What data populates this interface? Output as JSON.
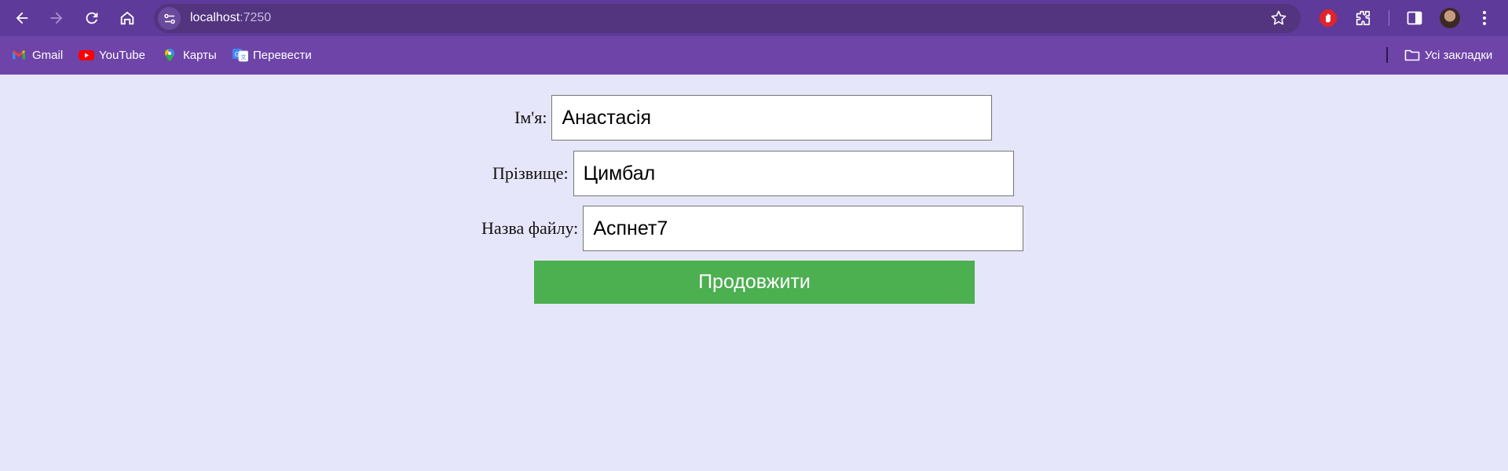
{
  "browser": {
    "url_host": "localhost",
    "url_port": ":7250",
    "bookmarks": [
      {
        "label": "Gmail",
        "icon": "gmail-icon"
      },
      {
        "label": "YouTube",
        "icon": "youtube-icon"
      },
      {
        "label": "Карты",
        "icon": "maps-icon"
      },
      {
        "label": "Перевести",
        "icon": "translate-icon"
      }
    ],
    "all_bookmarks_label": "Усі закладки",
    "colors": {
      "toolbar": "#5e3a9a",
      "bookmarks_bar": "#6e44a8"
    }
  },
  "form": {
    "first_name": {
      "label": "Ім'я:",
      "value": "Анастасія"
    },
    "last_name": {
      "label": "Прізвище:",
      "value": "Цимбал"
    },
    "file_name": {
      "label": "Назва файлу:",
      "value": "Аспнет7"
    },
    "submit_label": "Продовжити",
    "colors": {
      "page_background": "#e6e6fa",
      "button": "#4caf50"
    }
  }
}
